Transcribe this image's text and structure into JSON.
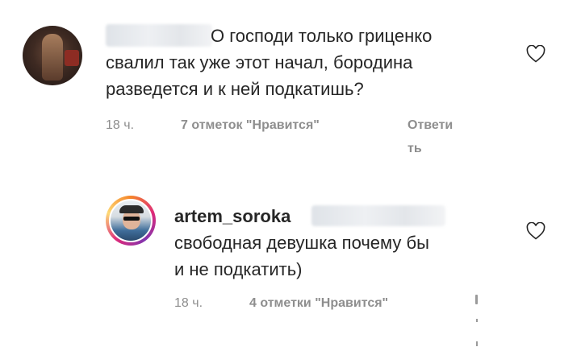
{
  "comments": [
    {
      "text_line1": "О господи только гриценко",
      "text_line2": "свалил так уже этот начал, бородина",
      "text_line3": "разведется и к ней подкатишь?",
      "time": "18 ч.",
      "likes": "7 отметок \"Нравится\"",
      "reply_part1": "Ответи",
      "reply_part2": "ть"
    },
    {
      "username": "artem_soroka",
      "text_line1": "свободная девушка почему бы",
      "text_line2": "и не подкатить)",
      "time": "18 ч.",
      "likes": "4 отметки \"Нравится\""
    }
  ],
  "icons": {
    "like": "heart-outline-icon"
  },
  "colors": {
    "text": "#262626",
    "meta": "#8e8e8e",
    "icon": "#262626"
  }
}
